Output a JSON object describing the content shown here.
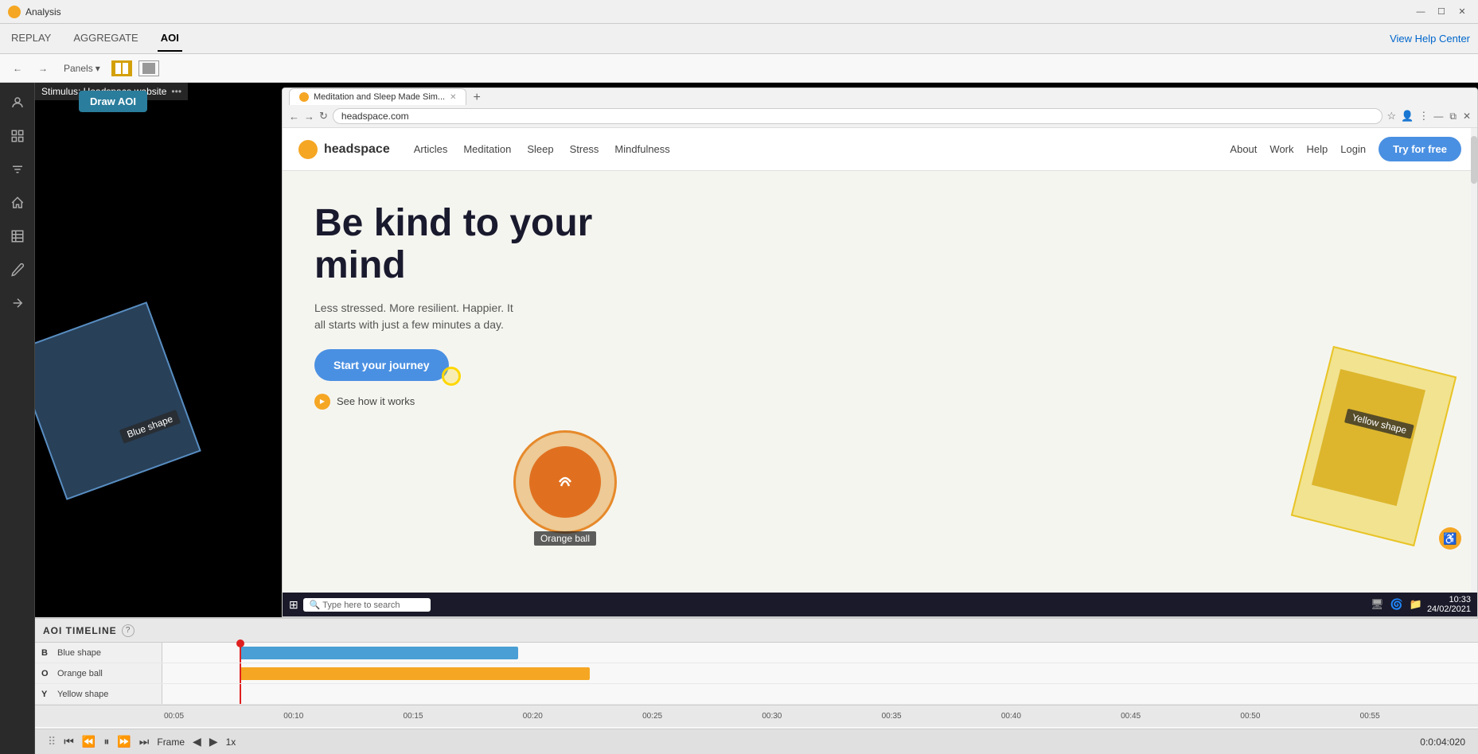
{
  "app": {
    "title": "Analysis",
    "icon_color": "#f5a623"
  },
  "window_controls": {
    "minimize": "—",
    "restore": "☐",
    "close": "✕"
  },
  "nav": {
    "tabs": [
      {
        "label": "REPLAY",
        "active": false
      },
      {
        "label": "AGGREGATE",
        "active": false
      },
      {
        "label": "AOI",
        "active": true
      }
    ],
    "view_help": "View Help Center"
  },
  "toolbar": {
    "back": "←",
    "forward": "→",
    "panels_label": "Panels",
    "panels_dropdown": "▾"
  },
  "sidebar": {
    "icons": [
      {
        "name": "user-icon",
        "symbol": "👤"
      },
      {
        "name": "grid-icon",
        "symbol": "▦"
      },
      {
        "name": "filter-icon",
        "symbol": "⊟"
      },
      {
        "name": "home-icon",
        "symbol": "⌂"
      },
      {
        "name": "table-icon",
        "symbol": "▤"
      },
      {
        "name": "pen-icon",
        "symbol": "✎"
      },
      {
        "name": "export-icon",
        "symbol": "→"
      }
    ]
  },
  "stimulus": {
    "title": "Stimulus: Headspace website",
    "draw_aoi_label": "Draw AOI"
  },
  "browser": {
    "url": "headspace.com",
    "tab_label": "Meditation and Sleep Made Sim...",
    "favicon_color": "#f5a623"
  },
  "headspace": {
    "logo_text": "headspace",
    "nav_links": [
      "Articles",
      "Meditation",
      "Sleep",
      "Stress",
      "Mindfulness"
    ],
    "nav_right_links": [
      "About",
      "Work",
      "Help",
      "Login"
    ],
    "try_btn": "Try for free",
    "hero_title": "Be kind to your mind",
    "hero_subtitle": "Less stressed. More resilient. Happier. It all starts with just a few minutes a day.",
    "start_btn": "Start your journey",
    "see_how": "See how it works"
  },
  "aoi_shapes": {
    "blue": {
      "label": "Blue shape",
      "key": "B"
    },
    "orange": {
      "label": "Orange ball",
      "key": "O"
    },
    "yellow": {
      "label": "Yellow shape",
      "key": "Y"
    }
  },
  "timeline": {
    "title": "AOI TIMELINE",
    "tracks": [
      {
        "key": "B",
        "name": "Blue shape",
        "bar_color": "#4a9fd4",
        "bar_start_pct": 0,
        "bar_width_pct": 55
      },
      {
        "key": "O",
        "name": "Orange ball",
        "bar_color": "#f5a623",
        "bar_start_pct": 0,
        "bar_width_pct": 70
      },
      {
        "key": "Y",
        "name": "Yellow shape",
        "bar_color": "#f5d020",
        "bar_start_pct": 0,
        "bar_width_pct": 0
      }
    ],
    "ruler_marks": [
      "00:05",
      "00:10",
      "00:15",
      "00:20",
      "00:25",
      "00:30",
      "00:35",
      "00:40",
      "00:45",
      "00:50",
      "00:55"
    ]
  },
  "playback": {
    "frame_label": "Frame",
    "speed": "1x",
    "time": "0:0:04:020"
  }
}
